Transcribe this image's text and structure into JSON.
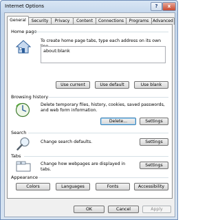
{
  "window": {
    "title": "Internet Options",
    "help_glyph": "?",
    "close_glyph": "x"
  },
  "tabs": [
    "General",
    "Security",
    "Privacy",
    "Content",
    "Connections",
    "Programs",
    "Advanced"
  ],
  "home_page": {
    "heading": "Home page",
    "description": "To create home page tabs, type each address on its own line.",
    "value": "about:blank",
    "buttons": {
      "use_current": "Use current",
      "use_default": "Use default",
      "use_blank": "Use blank"
    }
  },
  "browsing_history": {
    "heading": "Browsing history",
    "description": "Delete temporary files, history, cookies, saved passwords, and web form information.",
    "buttons": {
      "delete": "Delete...",
      "settings": "Settings"
    }
  },
  "search": {
    "heading": "Search",
    "description": "Change search defaults.",
    "buttons": {
      "settings": "Settings"
    }
  },
  "tabs_section": {
    "heading": "Tabs",
    "description": "Change how webpages are displayed in tabs.",
    "buttons": {
      "settings": "Settings"
    }
  },
  "appearance": {
    "heading": "Appearance",
    "buttons": {
      "colors": "Colors",
      "languages": "Languages",
      "fonts": "Fonts",
      "accessibility": "Accessibility"
    }
  },
  "footer": {
    "ok": "OK",
    "cancel": "Cancel",
    "apply": "Apply"
  }
}
